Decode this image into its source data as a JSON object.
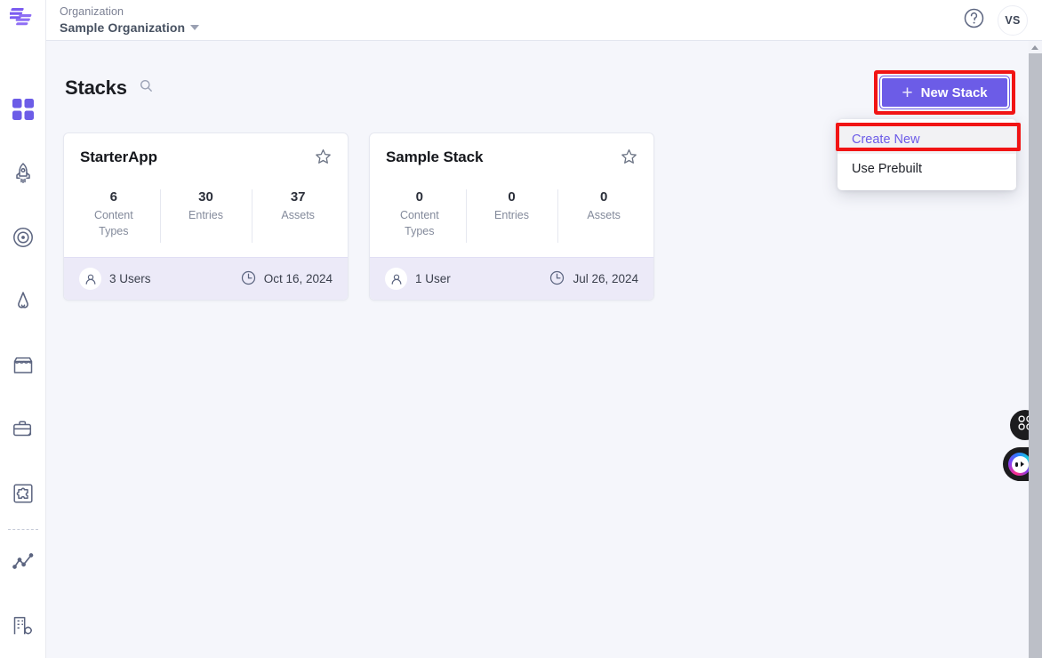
{
  "brand": {
    "logo_name": "contentstack-logo",
    "accent": "#6c5ce7",
    "annotation_color": "#f11414"
  },
  "topbar": {
    "org_kicker": "Organization",
    "org_name": "Sample Organization",
    "help_icon": "question-circle-icon",
    "avatar_initials": "VS"
  },
  "sidebar": {
    "items": [
      {
        "icon": "grid-apps-icon",
        "active": true
      },
      {
        "icon": "rocket-icon",
        "active": false
      },
      {
        "icon": "target-bullseye-icon",
        "active": false
      },
      {
        "icon": "launch-icon",
        "active": false
      },
      {
        "icon": "marketplace-store-icon",
        "active": false
      },
      {
        "icon": "briefcase-sparkle-icon",
        "active": false
      },
      {
        "icon": "puzzle-piece-icon",
        "active": false
      },
      {
        "icon": "line-chart-icon",
        "active": false
      },
      {
        "icon": "org-settings-icon",
        "active": false
      }
    ]
  },
  "page": {
    "title": "Stacks",
    "search_icon": "search-icon"
  },
  "new_stack": {
    "label": "New Stack",
    "plus_icon": "plus-icon",
    "annotated": true
  },
  "dropdown": {
    "items": [
      {
        "label": "Create New",
        "selected": true,
        "annotated": true
      },
      {
        "label": "Use Prebuilt",
        "selected": false,
        "annotated": false
      }
    ]
  },
  "stacks": [
    {
      "name": "StarterApp",
      "favorite_icon": "star-outline-icon",
      "stats": [
        {
          "value": "6",
          "label": "Content Types"
        },
        {
          "value": "30",
          "label": "Entries"
        },
        {
          "value": "37",
          "label": "Assets"
        }
      ],
      "users_icon": "user-icon",
      "users": "3 Users",
      "date_icon": "clock-icon",
      "date": "Oct 16, 2024"
    },
    {
      "name": "Sample Stack",
      "favorite_icon": "star-outline-icon",
      "stats": [
        {
          "value": "0",
          "label": "Content Types"
        },
        {
          "value": "0",
          "label": "Entries"
        },
        {
          "value": "0",
          "label": "Assets"
        }
      ],
      "users_icon": "user-icon",
      "users": "1 User",
      "date_icon": "clock-icon",
      "date": "Jul 26, 2024"
    }
  ],
  "floating": {
    "apps_icon": "grid-apps-icon",
    "bot_icon": "chat-bot-avatar-icon"
  }
}
